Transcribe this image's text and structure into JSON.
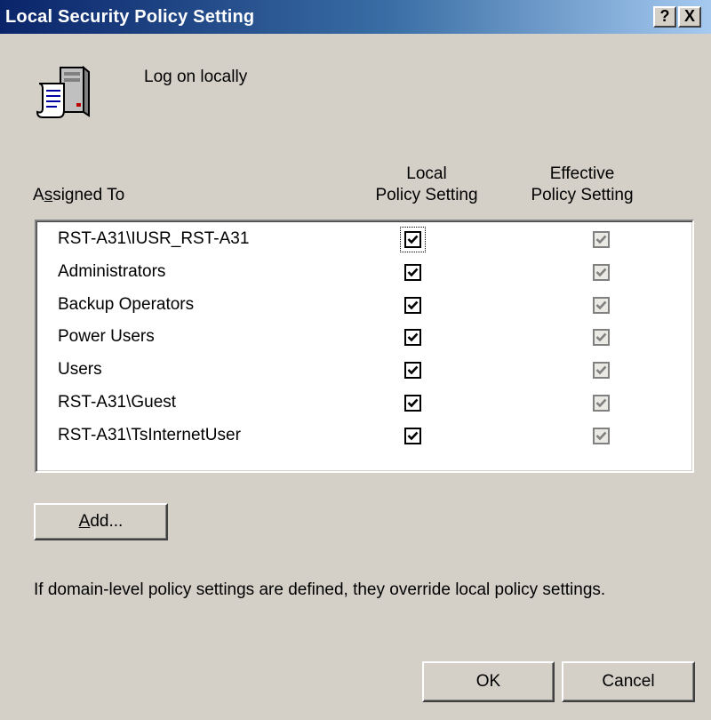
{
  "window": {
    "title": "Local Security Policy Setting",
    "help_label": "?",
    "close_label": "X"
  },
  "policy": {
    "name": "Log on locally",
    "icon": "policy-server-scroll-icon"
  },
  "columns": {
    "assigned_to": "Assigned To",
    "assigned_to_access_key": "s",
    "local_line1": "Local",
    "local_line2": "Policy Setting",
    "effective_line1": "Effective",
    "effective_line2": "Policy Setting"
  },
  "rows": [
    {
      "label": "RST-A31\\IUSR_RST-A31",
      "local": true,
      "effective": true,
      "focused": true
    },
    {
      "label": "Administrators",
      "local": true,
      "effective": true
    },
    {
      "label": "Backup Operators",
      "local": true,
      "effective": true
    },
    {
      "label": "Power Users",
      "local": true,
      "effective": true
    },
    {
      "label": "Users",
      "local": true,
      "effective": true
    },
    {
      "label": "RST-A31\\Guest",
      "local": true,
      "effective": true
    },
    {
      "label": "RST-A31\\TsInternetUser",
      "local": true,
      "effective": true
    }
  ],
  "buttons": {
    "add": "Add...",
    "add_access_key": "A",
    "ok": "OK",
    "cancel": "Cancel"
  },
  "note": "If domain-level policy settings are defined, they override local policy settings.",
  "colors": {
    "title_gradient_start": "#0a246a",
    "title_gradient_end": "#a6caf0",
    "dialog_face": "#d4d0c8"
  }
}
